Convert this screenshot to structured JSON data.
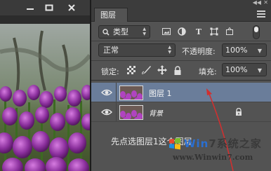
{
  "panel": {
    "tab_label": "图层",
    "filter": {
      "kind_label": "类型",
      "icons": [
        "image-filter-icon",
        "adjustment-filter-icon",
        "type-filter-icon",
        "shape-filter-icon",
        "smart-object-filter-icon"
      ]
    },
    "blend_mode": "正常",
    "opacity_label": "不透明度:",
    "opacity_value": "100%",
    "lock_label": "锁定:",
    "fill_label": "填充:",
    "fill_value": "100%"
  },
  "layers": [
    {
      "name": "图层 1",
      "selected": true,
      "visible": true,
      "locked": false
    },
    {
      "name": "背景",
      "selected": false,
      "visible": true,
      "locked": true
    }
  ],
  "annotation": {
    "caption": "先点选图层1这个图层"
  },
  "watermark": {
    "line1_a": "Win",
    "line1_b": "7系统之家",
    "line2": "www.Winwin7.com"
  },
  "colors": {
    "panel_bg": "#535353",
    "selected_layer": "#6a7d9a",
    "annotation_arrow": "#d03030"
  }
}
